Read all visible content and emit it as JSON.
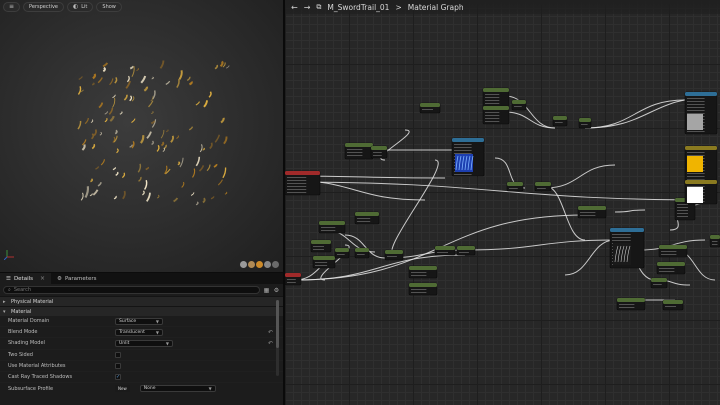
{
  "viewport": {
    "toolbar": [
      {
        "icon": "hamburger-menu-icon",
        "glyph": "≡",
        "label": ""
      },
      {
        "icon": "perspective-icon",
        "glyph": "",
        "label": "Perspective"
      },
      {
        "icon": "lit-icon",
        "glyph": "◐",
        "label": "Lit"
      },
      {
        "icon": "show-icon",
        "glyph": "",
        "label": "Show"
      }
    ],
    "preview_colors": [
      "#e0b040",
      "#f3e7c9",
      "#b07a20"
    ]
  },
  "details": {
    "tabs": [
      {
        "icon": "details-icon",
        "label": "Details",
        "active": true
      },
      {
        "icon": "parameters-icon",
        "label": "Parameters",
        "active": false
      }
    ],
    "search_placeholder": "Search",
    "categories": {
      "physical_material": "Physical Material",
      "material": "Material"
    },
    "properties": [
      {
        "name": "Material Domain",
        "type": "dropdown",
        "value": "Surface"
      },
      {
        "name": "Blend Mode",
        "type": "dropdown",
        "value": "Translucent",
        "reset": true
      },
      {
        "name": "Shading Model",
        "type": "dropdown",
        "value": "Unlit",
        "reset": true
      },
      {
        "name": "Two Sided",
        "type": "checkbox",
        "checked": false
      },
      {
        "name": "Use Material Attributes",
        "type": "checkbox",
        "checked": false
      },
      {
        "name": "Cast Ray Traced Shadows",
        "type": "checkbox",
        "checked": true
      }
    ],
    "subsurface": {
      "name": "Subsurface Profile",
      "value": "None",
      "new_label": "New"
    }
  },
  "graph": {
    "breadcrumb_app": "M_SwordTrail_01",
    "breadcrumb_sep": ">",
    "breadcrumb_page": "Material Graph",
    "node_colors": {
      "parameter": "#4f6b34",
      "texture": "#2e6e96",
      "input": "#a02a2a",
      "output": "#8a7a20"
    }
  }
}
